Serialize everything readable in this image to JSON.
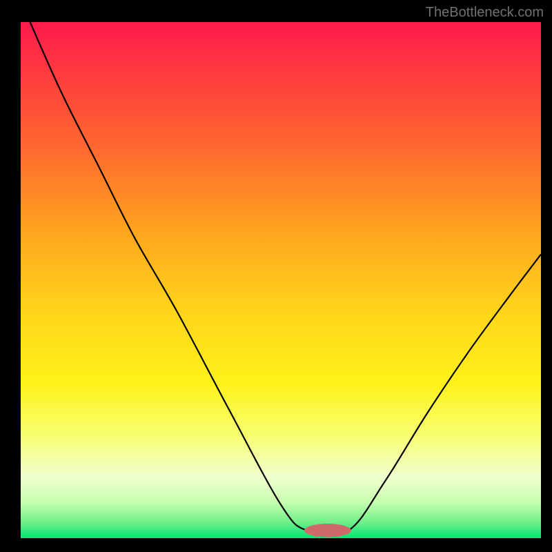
{
  "watermark": "TheBottleneck.com",
  "chart_data": {
    "type": "line",
    "title": "",
    "xlabel": "",
    "ylabel": "",
    "xlim": [
      0,
      100
    ],
    "ylim": [
      0,
      100
    ],
    "bg_gradient": {
      "stops": [
        {
          "offset": 0.0,
          "color": "#ff1a4d"
        },
        {
          "offset": 0.1,
          "color": "#ff3b3e"
        },
        {
          "offset": 0.25,
          "color": "#ff6a2e"
        },
        {
          "offset": 0.4,
          "color": "#ffa31f"
        },
        {
          "offset": 0.55,
          "color": "#ffd21a"
        },
        {
          "offset": 0.7,
          "color": "#fff21a"
        },
        {
          "offset": 0.8,
          "color": "#f7ff70"
        },
        {
          "offset": 0.88,
          "color": "#f0ffcf"
        },
        {
          "offset": 0.93,
          "color": "#c8ffaf"
        },
        {
          "offset": 0.97,
          "color": "#6df088"
        },
        {
          "offset": 1.0,
          "color": "#00e570"
        }
      ]
    },
    "left_curve": {
      "x": [
        1.8,
        8.0,
        15.0,
        22.0,
        30.0,
        40.0,
        50.0,
        55.0
      ],
      "y": [
        100.0,
        86.0,
        72.0,
        58.0,
        44.0,
        25.0,
        6.5,
        1.5
      ]
    },
    "flat_segment": {
      "x": [
        55.0,
        63.0
      ],
      "y": [
        1.5,
        1.5
      ]
    },
    "right_curve": {
      "x": [
        63.0,
        70.0,
        78.0,
        86.0,
        94.0,
        100.0
      ],
      "y": [
        1.5,
        11.0,
        24.0,
        36.0,
        47.0,
        55.0
      ]
    },
    "marker": {
      "x": 59.0,
      "y": 1.5,
      "rx": 4.5,
      "ry": 1.3,
      "fill": "#d06a68"
    }
  }
}
